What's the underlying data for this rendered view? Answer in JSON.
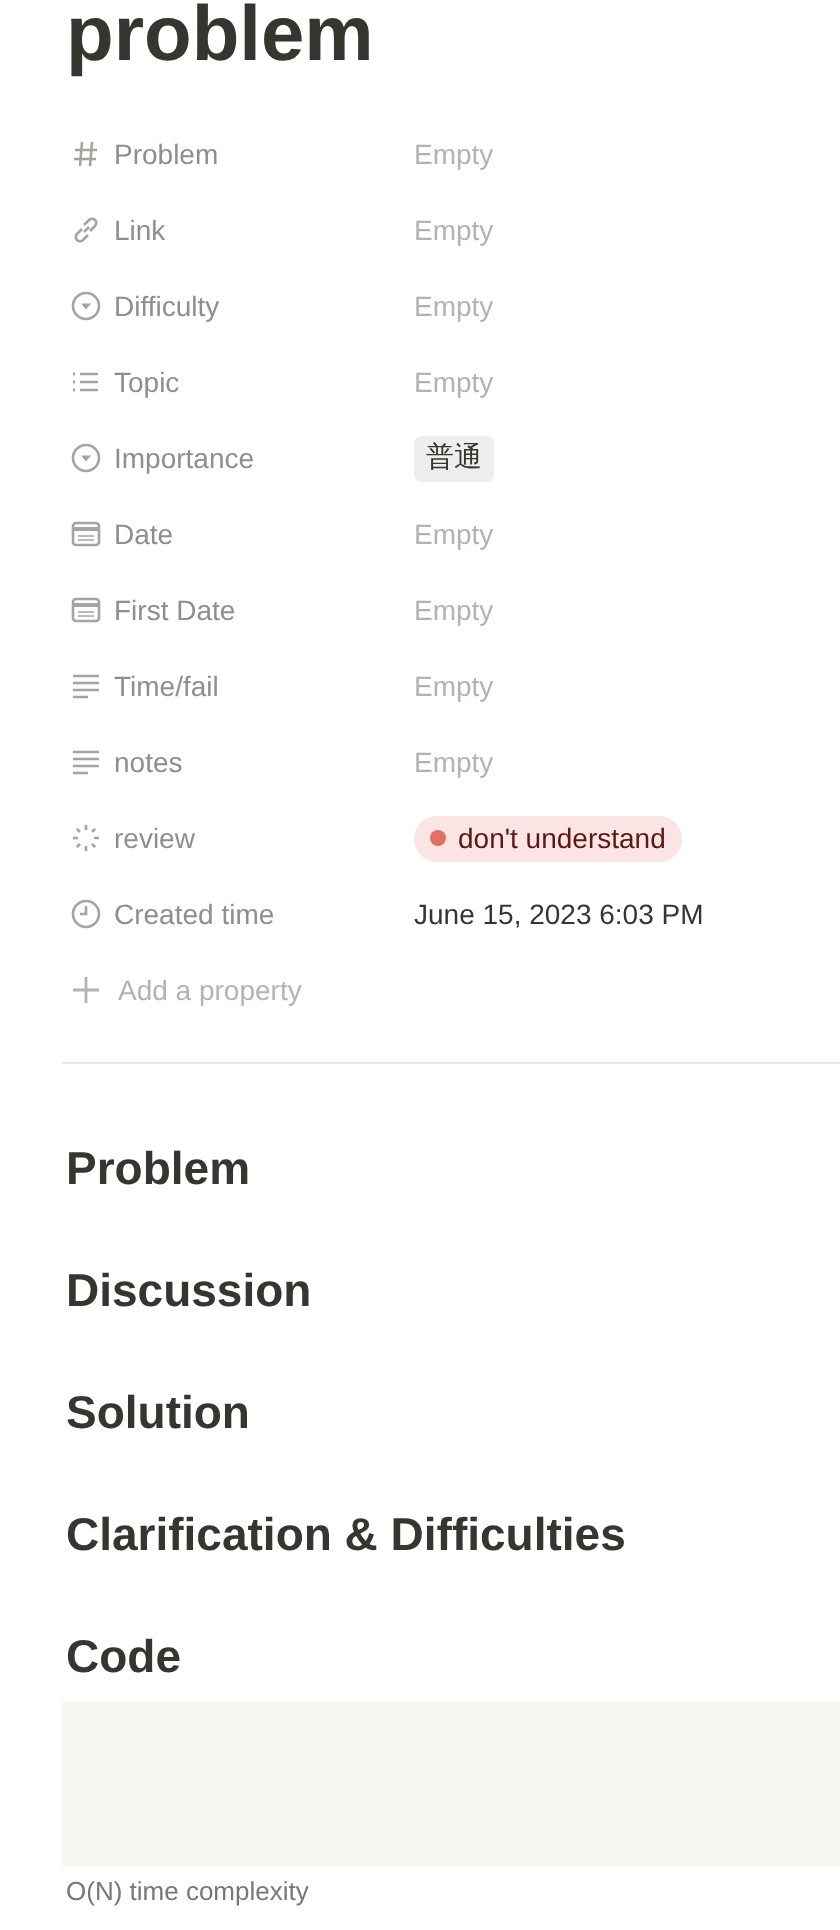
{
  "title": "problem",
  "properties": [
    {
      "kind": "hash",
      "label": "Problem",
      "value": {
        "kind": "empty",
        "text": "Empty"
      }
    },
    {
      "kind": "link",
      "label": "Link",
      "value": {
        "kind": "empty",
        "text": "Empty"
      }
    },
    {
      "kind": "select",
      "label": "Difficulty",
      "value": {
        "kind": "empty",
        "text": "Empty"
      }
    },
    {
      "kind": "multi",
      "label": "Topic",
      "value": {
        "kind": "empty",
        "text": "Empty"
      }
    },
    {
      "kind": "select",
      "label": "Importance",
      "value": {
        "kind": "tag",
        "text": "普通"
      }
    },
    {
      "kind": "date",
      "label": "Date",
      "value": {
        "kind": "empty",
        "text": "Empty"
      }
    },
    {
      "kind": "date",
      "label": "First Date",
      "value": {
        "kind": "empty",
        "text": "Empty"
      }
    },
    {
      "kind": "text",
      "label": "Time/fail",
      "value": {
        "kind": "empty",
        "text": "Empty"
      }
    },
    {
      "kind": "text",
      "label": "notes",
      "value": {
        "kind": "empty",
        "text": "Empty"
      }
    },
    {
      "kind": "status",
      "label": "review",
      "value": {
        "kind": "status",
        "text": "don't understand",
        "color": "#e16f64"
      }
    },
    {
      "kind": "clock",
      "label": "Created time",
      "value": {
        "kind": "text",
        "text": "June 15, 2023 6:03 PM"
      }
    }
  ],
  "add_property": "Add a property",
  "headings": [
    "Problem",
    "Discussion",
    "Solution",
    "Clarification & Difficulties",
    "Code"
  ],
  "caption": "O(N) time complexity"
}
